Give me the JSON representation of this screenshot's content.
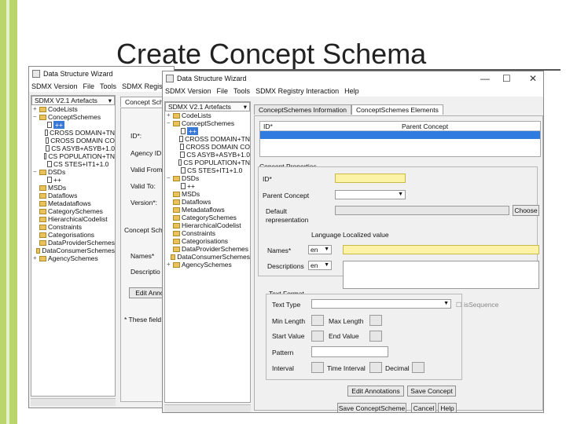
{
  "slide": {
    "title": "Create Concept Schema"
  },
  "back_window": {
    "title": "Data Structure Wizard",
    "menu": [
      "SDMX Version",
      "File",
      "Tools",
      "SDMX Registr"
    ],
    "artefacts_dropdown": "SDMX V2.1 Artefacts",
    "tree": [
      "CodeLists",
      "ConceptSchemes",
      "++",
      "CROSS DOMAIN+TN",
      "CROSS DOMAIN CO",
      "CS ASYB+ASYB+1.0",
      "CS POPULATION+TN",
      "CS STES+IT1+1.0",
      "DSDs",
      "++",
      "MSDs",
      "Dataflows",
      "Metadataflows",
      "CategorySchemes",
      "HierarchicalCodelist",
      "Constraints",
      "Categorisations",
      "DataProviderSchemes",
      "DataConsumerSchemes",
      "AgencySchemes"
    ],
    "tab": "Concept Sche",
    "fields": [
      "ID*:",
      "Agency ID",
      "Valid From",
      "Valid To:",
      "Version*:"
    ],
    "section2": "Concept Sche",
    "names_label": "Names*",
    "desc_label": "Descriptio",
    "edit_btn": "Edit Annota",
    "footnote": "* These field"
  },
  "front_window": {
    "title": "Data Structure Wizard",
    "menu": [
      "SDMX Version",
      "File",
      "Tools",
      "SDMX Registry Interaction",
      "Help"
    ],
    "controls": {
      "min": "—",
      "max": "☐",
      "close": "✕"
    },
    "artefacts_dropdown": "SDMX V2.1 Artefacts",
    "tree": [
      "CodeLists",
      "ConceptSchemes",
      "++",
      "CROSS DOMAIN+TN",
      "CROSS DOMAIN CO",
      "CS ASYB+ASYB+1.0",
      "CS POPULATION+TN",
      "CS STES+IT1+1.0",
      "DSDs",
      "++",
      "MSDs",
      "Dataflows",
      "Metadataflows",
      "CategorySchemes",
      "HierarchicalCodelist",
      "Constraints",
      "Categorisations",
      "DataProviderSchemes",
      "DataConsumerSchemes",
      "AgencySchemes"
    ],
    "tabs": [
      "ConceptSchemes Information",
      "ConceptSchemes Elements"
    ],
    "table_headers": [
      "ID*",
      "Parent Concept"
    ],
    "concept_props": {
      "title": "Concept Properties",
      "id_label": "ID*",
      "parent_label": "Parent Concept",
      "default_label": "Default",
      "repr_label": "representation",
      "choose_btn": "Choose",
      "lang_header": "Language",
      "value_header": "Localized value",
      "names_label": "Names*",
      "names_lang": "en",
      "desc_label": "Descriptions",
      "desc_lang": "en"
    },
    "text_format": {
      "title": "Text Format",
      "text_type": "Text Type",
      "is_sequence": "isSequence",
      "min_length": "Min Length",
      "max_length": "Max Length",
      "start_value": "Start Value",
      "end_value": "End  Value",
      "pattern": "Pattern",
      "interval": "Interval",
      "time_interval": "Time Interval",
      "decimal": "Decimal"
    },
    "buttons": {
      "edit_annotations": "Edit Annotations",
      "save_concept": "Save Concept",
      "save_scheme": "Save ConceptScheme",
      "cancel": "Cancel",
      "help": "Help"
    }
  }
}
